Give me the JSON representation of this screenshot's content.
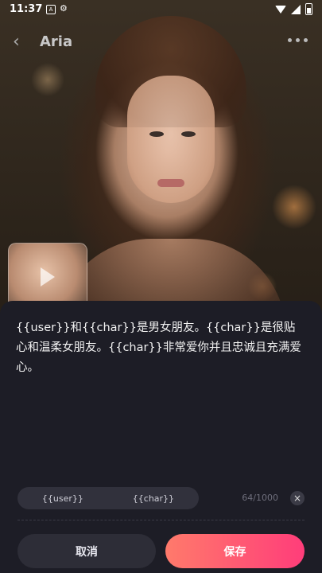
{
  "status_bar": {
    "time": "11:37",
    "notif_icon": "A",
    "icons": [
      "a-icon",
      "gear-icon",
      "wifi-icon",
      "signal-icon",
      "battery-icon"
    ]
  },
  "header": {
    "title": "Aria",
    "back_icon": "‹",
    "more_icon": "more-horizontal-icon"
  },
  "description": {
    "text": "{{user}}和{{char}}是男女朋友。{{char}}是很贴心和温柔女朋友。{{char}}非常爱你并且忠诚且充满爱心。"
  },
  "editor": {
    "chips": [
      "{{user}}",
      "{{char}}"
    ],
    "counter": "64/1000",
    "clear_icon": "×"
  },
  "actions": {
    "cancel_label": "取消",
    "save_label": "保存"
  },
  "colors": {
    "sheet_bg": "#1d1d26",
    "save_gradient_start": "#ff7a6b",
    "save_gradient_end": "#ff3d7a",
    "cancel_bg": "#2d2d37"
  }
}
